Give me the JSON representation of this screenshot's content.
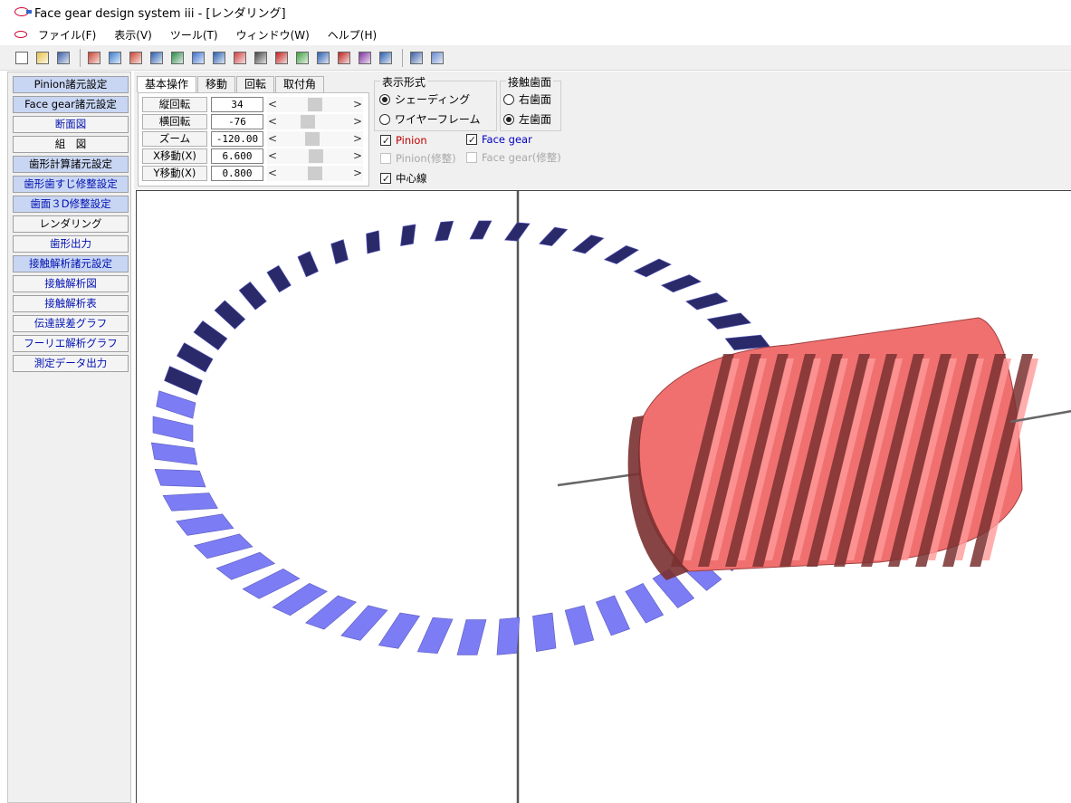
{
  "window": {
    "title": "Face gear design system iii  - [レンダリング]"
  },
  "menu": [
    "ファイル(F)",
    "表示(V)",
    "ツール(T)",
    "ウィンドウ(W)",
    "ヘルプ(H)"
  ],
  "toolbar": {
    "icons": [
      "new-file-icon",
      "open-folder-icon",
      "save-icon",
      "pinion-icon",
      "face-gear-icon",
      "cross-section-icon",
      "assembly-icon",
      "tooth-form-icon",
      "modification-icon",
      "surface-3d-icon",
      "rendering-icon",
      "output-icon",
      "contact-icon",
      "contact-map-icon",
      "contact-table-icon",
      "transmission-error-icon",
      "fourier-icon",
      "measurement-icon",
      "window-icon",
      "help-icon"
    ]
  },
  "sidebar": {
    "items": [
      {
        "label": "Pinion諸元設定",
        "highlight": true,
        "blue": false
      },
      {
        "label": "Face gear諸元設定",
        "highlight": true,
        "blue": false
      },
      {
        "label": "断面図",
        "highlight": false,
        "blue": true
      },
      {
        "label": "組　図",
        "highlight": false,
        "blue": false
      },
      {
        "label": "歯形計算諸元設定",
        "highlight": true,
        "blue": false
      },
      {
        "label": "歯形歯すじ修整設定",
        "highlight": true,
        "blue": true
      },
      {
        "label": "歯面３D修整設定",
        "highlight": true,
        "blue": true
      },
      {
        "label": "レンダリング",
        "highlight": false,
        "blue": false
      },
      {
        "label": "歯形出力",
        "highlight": false,
        "blue": true
      },
      {
        "label": "接触解析諸元設定",
        "highlight": true,
        "blue": true
      },
      {
        "label": "接触解析図",
        "highlight": false,
        "blue": true
      },
      {
        "label": "接触解析表",
        "highlight": false,
        "blue": true
      },
      {
        "label": "伝達誤差グラフ",
        "highlight": false,
        "blue": true
      },
      {
        "label": "フーリエ解析グラフ",
        "highlight": false,
        "blue": true
      },
      {
        "label": "測定データ出力",
        "highlight": false,
        "blue": true
      }
    ]
  },
  "tabs": [
    "基本操作",
    "移動",
    "回転",
    "取付角"
  ],
  "controls": [
    {
      "label": "縦回転",
      "value": "34",
      "level": 0.5
    },
    {
      "label": "横回転",
      "value": "-76",
      "level": 0.38
    },
    {
      "label": "ズーム",
      "value": "-120.00",
      "level": 0.45
    },
    {
      "label": "X移動(X)",
      "value": "6.600",
      "level": 0.52
    },
    {
      "label": "Y移動(X)",
      "value": "0.800",
      "level": 0.5
    }
  ],
  "display_mode": {
    "title": "表示形式",
    "shading": "シェーディング",
    "wireframe": "ワイヤーフレーム",
    "selected": "shading"
  },
  "contact_face": {
    "title": "接触歯面",
    "right": "右歯面",
    "left": "左歯面",
    "selected": "left"
  },
  "checks": {
    "pinion": "Pinion",
    "face_gear": "Face gear",
    "pinion_mod": "Pinion(修整)",
    "face_gear_mod": "Face gear(修整)",
    "center_line": "中心線"
  },
  "colors": {
    "face_gear": "#7c7cf4",
    "face_gear_dark": "#2a2a6a",
    "pinion": "#f07070",
    "pinion_dark": "#7a3030",
    "pinion_label": "#c00000",
    "face_gear_label": "#0000c0"
  }
}
